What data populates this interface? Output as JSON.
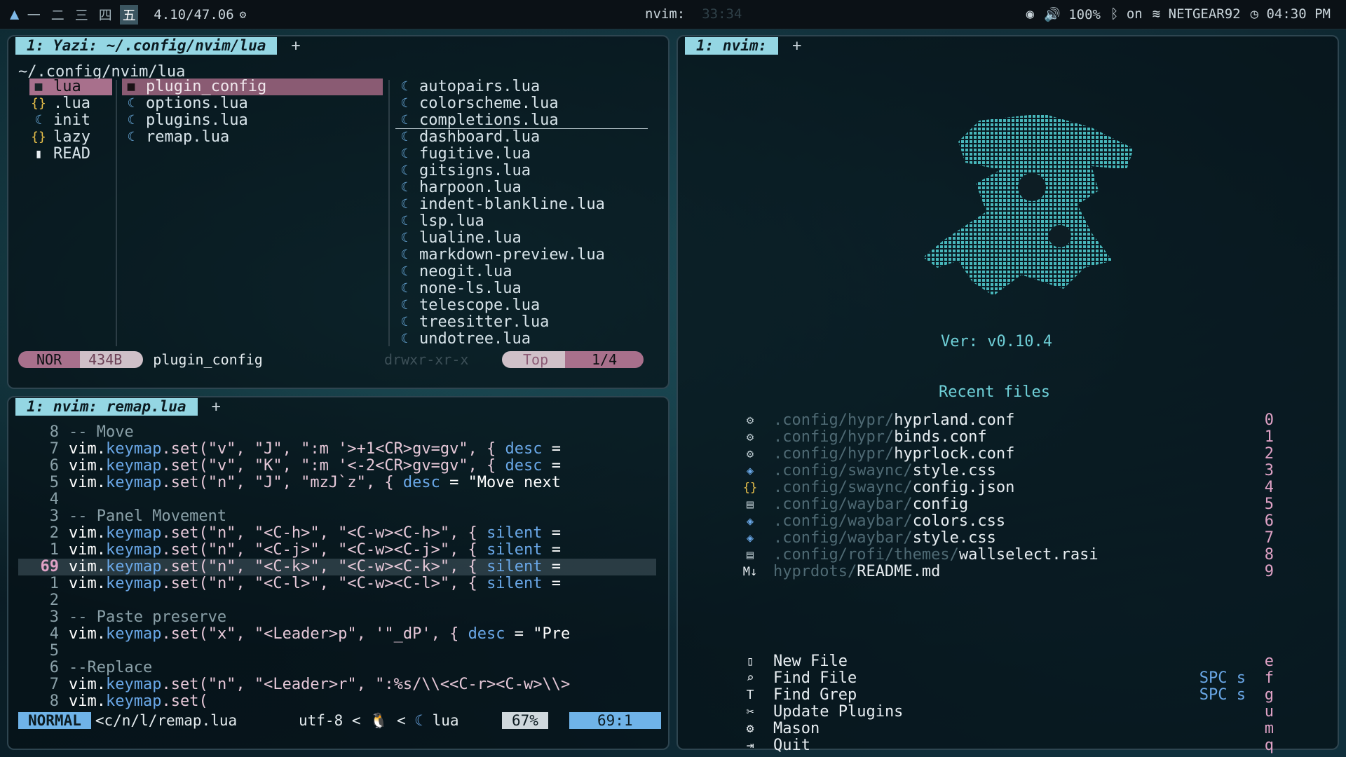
{
  "topbar": {
    "workspaces": [
      "一",
      "二",
      "三",
      "四",
      "五"
    ],
    "active_workspace": 4,
    "version": "4.10/47.06",
    "center_title": "nvim:",
    "center_dim": "33:34",
    "volume": "100%",
    "bluetooth": "on",
    "wifi": "NETGEAR92",
    "clock": "04:30 PM"
  },
  "yazi": {
    "tab_label": "1: Yazi: ~/.config/nvim/lua",
    "plus": "+",
    "path": "~/.config/nvim/lua",
    "parent_items": [
      {
        "icon": "folder",
        "name": "lua"
      },
      {
        "icon": "brace",
        "name": ".lua"
      },
      {
        "icon": "moon",
        "name": "init"
      },
      {
        "icon": "brace",
        "name": "lazy"
      },
      {
        "icon": "doc",
        "name": "READ"
      }
    ],
    "current_items": [
      {
        "icon": "folder",
        "name": "plugin_config"
      },
      {
        "icon": "moon",
        "name": "options.lua"
      },
      {
        "icon": "moon",
        "name": "plugins.lua"
      },
      {
        "icon": "moon",
        "name": "remap.lua"
      }
    ],
    "preview_items": [
      "autopairs.lua",
      "colorscheme.lua",
      "completions.lua",
      "dashboard.lua",
      "fugitive.lua",
      "gitsigns.lua",
      "harpoon.lua",
      "indent-blankline.lua",
      "lsp.lua",
      "lualine.lua",
      "markdown-preview.lua",
      "neogit.lua",
      "none-ls.lua",
      "telescope.lua",
      "treesitter.lua",
      "undotree.lua"
    ],
    "status": {
      "mode": "NOR",
      "size": "434B",
      "name": "plugin_config",
      "perm": "drwxr-xr-x",
      "scroll": "Top",
      "position": "1/4"
    }
  },
  "editor": {
    "tab_label": "1: nvim: remap.lua",
    "plus": "+",
    "lines": [
      {
        "n": "8",
        "t": "-- Move",
        "kind": "cmt"
      },
      {
        "n": "7",
        "pre": "vim.",
        "fn": "keymap",
        "mid": ".set(\"v\", \"J\", \":m '>+1<CR>gv=gv\", { ",
        "d": "desc",
        "post": " ="
      },
      {
        "n": "6",
        "pre": "vim.",
        "fn": "keymap",
        "mid": ".set(\"v\", \"K\", \":m '<-2<CR>gv=gv\", { ",
        "d": "desc",
        "post": " ="
      },
      {
        "n": "5",
        "pre": "vim.",
        "fn": "keymap",
        "mid": ".set(\"n\", \"J\", \"mzJ`z\", { ",
        "d": "desc",
        "post": " = \"Move next"
      },
      {
        "n": "4",
        "t": "",
        "kind": "cmt"
      },
      {
        "n": "3",
        "t": "-- Panel Movement",
        "kind": "cmt"
      },
      {
        "n": "2",
        "pre": "vim.",
        "fn": "keymap",
        "mid": ".set(\"n\", \"<C-h>\", \"<C-w><C-h>\", { ",
        "d": "silent",
        "post": " ="
      },
      {
        "n": "1",
        "pre": "vim.",
        "fn": "keymap",
        "mid": ".set(\"n\", \"<C-j>\", \"<C-w><C-j>\", { ",
        "d": "silent",
        "post": " ="
      },
      {
        "n": "69",
        "pre": "vim.",
        "fn": "keymap",
        "mid": ".set(\"n\", \"<C-k>\", \"<C-w><C-k>\", { ",
        "d": "silent",
        "post": " =",
        "current": true
      },
      {
        "n": "1",
        "pre": "vim.",
        "fn": "keymap",
        "mid": ".set(\"n\", \"<C-l>\", \"<C-w><C-l>\", { ",
        "d": "silent",
        "post": " ="
      },
      {
        "n": "2",
        "t": "",
        "kind": "cmt"
      },
      {
        "n": "3",
        "t": "-- Paste preserve",
        "kind": "cmt"
      },
      {
        "n": "4",
        "pre": "vim.",
        "fn": "keymap",
        "mid": ".set(\"x\", \"<Leader>p\", '\"_dP', { ",
        "d": "desc",
        "post": " = \"Pre"
      },
      {
        "n": "5",
        "t": "",
        "kind": "cmt"
      },
      {
        "n": "6",
        "t": "--Replace",
        "kind": "cmt"
      },
      {
        "n": "7",
        "pre": "vim.",
        "fn": "keymap",
        "mid": ".set(\"n\", \"<Leader>r\", \":%s/\\\\<<C-r><C-w>\\\\>",
        "d": "",
        "post": ""
      },
      {
        "n": "8",
        "pre": "vim.",
        "fn": "keymap",
        "mid": ".set(",
        "d": "",
        "post": ""
      }
    ],
    "status": {
      "mode": "NORMAL",
      "file": "<c/n/l/remap.lua",
      "enc": "utf-8",
      "ft": "lua",
      "percent": "67%",
      "linecol": "69:1"
    }
  },
  "dashboard": {
    "tab_label": "1: nvim:",
    "plus": "+",
    "version": "Ver: v0.10.4",
    "recent_title": "Recent files",
    "recent": [
      {
        "icon": "gear",
        "dir": ".config/hypr/",
        "file": "hyprland.conf",
        "key": "0"
      },
      {
        "icon": "gear",
        "dir": ".config/hypr/",
        "file": "binds.conf",
        "key": "1"
      },
      {
        "icon": "gear",
        "dir": ".config/hypr/",
        "file": "hyprlock.conf",
        "key": "2"
      },
      {
        "icon": "css",
        "dir": ".config/swaync/",
        "file": "style.css",
        "key": "3"
      },
      {
        "icon": "json",
        "dir": ".config/swaync/",
        "file": "config.json",
        "key": "4"
      },
      {
        "icon": "doc",
        "dir": ".config/waybar/",
        "file": "config",
        "key": "5"
      },
      {
        "icon": "css",
        "dir": ".config/waybar/",
        "file": "colors.css",
        "key": "6"
      },
      {
        "icon": "css",
        "dir": ".config/waybar/",
        "file": "style.css",
        "key": "7"
      },
      {
        "icon": "doc",
        "dir": ".config/rofi/themes/",
        "file": "wallselect.rasi",
        "key": "8"
      },
      {
        "icon": "md",
        "dir": "hyprdots/",
        "file": "README.md",
        "key": "9"
      }
    ],
    "actions": [
      {
        "icon": "new-file",
        "label": "New File",
        "hint": "",
        "key": "e"
      },
      {
        "icon": "search",
        "label": "Find File",
        "hint": "SPC s",
        "key": "f"
      },
      {
        "icon": "text",
        "label": "Find Grep",
        "hint": "SPC s",
        "key": "g"
      },
      {
        "icon": "tools",
        "label": "Update Plugins",
        "hint": "",
        "key": "u"
      },
      {
        "icon": "gear",
        "label": "Mason",
        "hint": "",
        "key": "m"
      },
      {
        "icon": "exit",
        "label": "Quit",
        "hint": "",
        "key": "q"
      }
    ]
  }
}
